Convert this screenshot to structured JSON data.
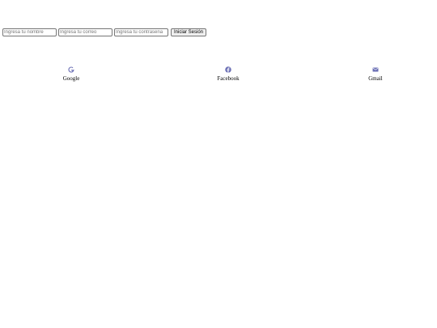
{
  "login_form": {
    "name_placeholder": "Ingresa tu nombre",
    "email_placeholder": "Ingresa tu correo",
    "password_placeholder": "Ingresa tu contraseña",
    "submit_label": "Iniciar Sesión"
  },
  "social": {
    "icon_color": "#6b6fb5",
    "items": [
      {
        "icon": "google-icon",
        "label": "Google"
      },
      {
        "icon": "facebook-icon",
        "label": "Facebook"
      },
      {
        "icon": "envelope-icon",
        "label": "Gmail"
      }
    ]
  }
}
